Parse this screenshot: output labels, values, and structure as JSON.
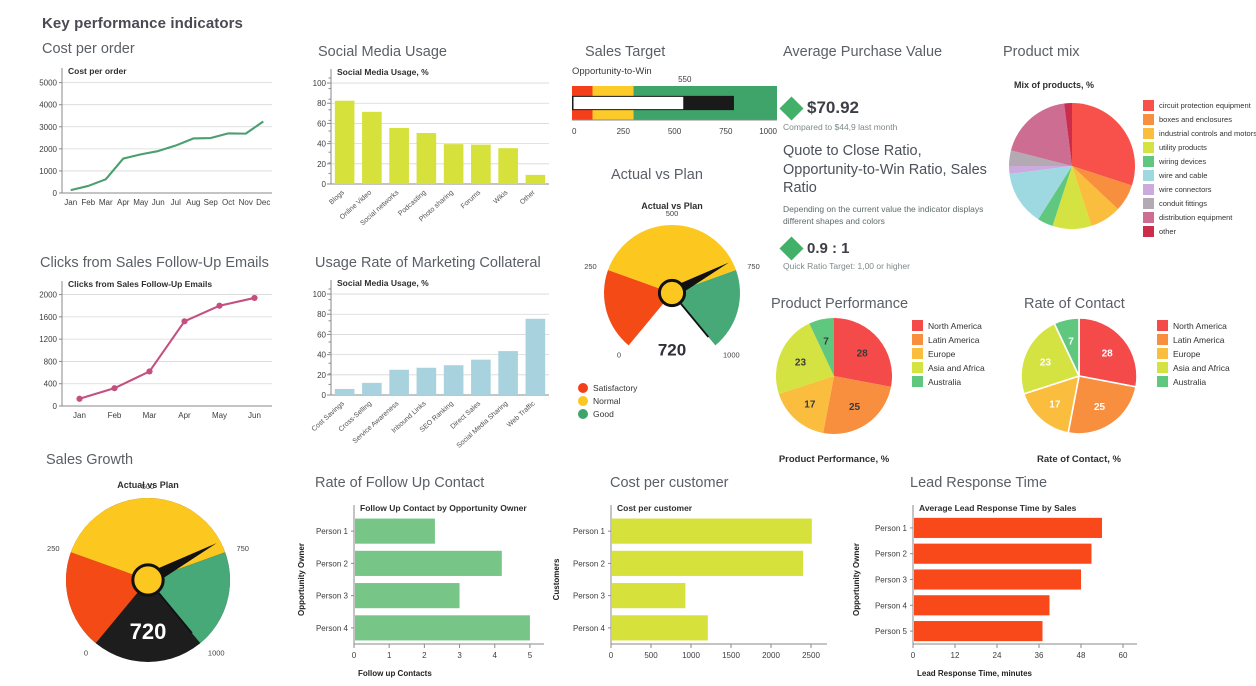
{
  "dashboard": {
    "title": "Key performance indicators"
  },
  "panels": {
    "cost_per_order": "Cost per order",
    "social_media_usage": "Social Media Usage",
    "sales_target": "Sales Target",
    "avg_purchase_value": "Average Purchase Value",
    "product_mix": "Product mix",
    "clicks_followup": "Clicks from Sales Follow-Up Emails",
    "usage_rate_collateral": "Usage Rate of Marketing Collateral",
    "actual_vs_plan": "Actual vs Plan",
    "product_performance": "Product Performance",
    "rate_of_contact": "Rate of Contact",
    "sales_growth": "Sales Growth",
    "rate_followup_contact": "Rate of Follow Up Contact",
    "cost_per_customer": "Cost per customer",
    "lead_response_time": "Lead Response Time"
  },
  "kpi": {
    "value": "$70.92",
    "compare": "Compared to $44,9 last month",
    "heading": "Quote to Close Ratio, Opportunity-to-Win Ratio, Sales Ratio",
    "description": "Depending on the current value the indicator displays different shapes and colors",
    "ratio_value": "0.9 : 1",
    "ratio_target": "Quick Ratio Target: 1,00 or higher",
    "diamond_color": "#43b06a"
  },
  "chart_data": [
    {
      "id": "cost_per_order",
      "type": "line",
      "title": "Cost per order",
      "categories": [
        "Jan",
        "Feb",
        "Mar",
        "Apr",
        "May",
        "Jun",
        "Jul",
        "Aug",
        "Sep",
        "Oct",
        "Nov",
        "Dec"
      ],
      "values": [
        130,
        320,
        620,
        1560,
        1750,
        1900,
        2150,
        2470,
        2490,
        2700,
        2690,
        3240
      ],
      "yticks": [
        0,
        1000,
        2000,
        3000,
        4000,
        5000
      ],
      "ylim": [
        0,
        5300
      ],
      "xlabel": "",
      "ylabel": "",
      "color": "#4a9e6f",
      "grid": true,
      "legend": "none"
    },
    {
      "id": "social_media_usage",
      "type": "bar",
      "title": "Social Media Usage, %",
      "categories": [
        "Blogs",
        "Online Video",
        "Social networks",
        "Podcasting",
        "Photo sharing",
        "Forums",
        "Wikis",
        "Other"
      ],
      "values": [
        82.5,
        71.5,
        55.5,
        50.5,
        39.5,
        39,
        35.5,
        9
      ],
      "yticks": [
        0,
        20,
        40,
        60,
        80,
        100
      ],
      "ylim": [
        0,
        105
      ],
      "color": "#d6e13c",
      "grid": true
    },
    {
      "id": "sales_target",
      "type": "bullet",
      "title": "Opportunity-to-Win",
      "xticks": [
        0,
        250,
        500,
        750,
        1000
      ],
      "xlim": [
        0,
        1000
      ],
      "ranges": [
        {
          "to": 100,
          "color": "#f43f1a"
        },
        {
          "to": 300,
          "color": "#fccb2a"
        },
        {
          "to": 1000,
          "color": "#3fa46a"
        }
      ],
      "measure": 790,
      "marker": 550,
      "marker_label": "550"
    },
    {
      "id": "actual_vs_plan_top",
      "type": "gauge",
      "title": "Actual vs Plan",
      "value": 720,
      "value_label": "720",
      "ticks": [
        0,
        250,
        500,
        750,
        1000
      ],
      "ranges": [
        {
          "from": 0,
          "to": 250,
          "color": "#f44a16",
          "name": "Satisfactory"
        },
        {
          "from": 250,
          "to": 750,
          "color": "#fcc81f",
          "name": "Normal"
        },
        {
          "from": 750,
          "to": 1000,
          "color": "#46a977",
          "name": "Good"
        }
      ],
      "legend": [
        {
          "label": "Satisfactory",
          "color": "#f4401a"
        },
        {
          "label": "Normal",
          "color": "#fcc81f"
        },
        {
          "label": "Good",
          "color": "#3fa46a"
        }
      ]
    },
    {
      "id": "product_mix",
      "type": "pie",
      "title": "Mix of products, %",
      "labels": [
        "circuit protection equipment",
        "boxes and enclosures",
        "industrial controls and motors",
        "utility products",
        "wiring devices",
        "wire and cable",
        "wire connectors",
        "conduit fittings",
        "distribution equipment",
        "other"
      ],
      "values": [
        30,
        7,
        8,
        10,
        4,
        14,
        2,
        4,
        19,
        2
      ],
      "colors": [
        "#f8504a",
        "#f78f3f",
        "#fbbd3d",
        "#d5e342",
        "#5fc77e",
        "#9ed9e2",
        "#ccaade",
        "#b3aab3",
        "#cd6d92",
        "#cc2d4a"
      ],
      "legend": "right",
      "show_values": false
    },
    {
      "id": "clicks_followup",
      "type": "line",
      "title": "Clicks from Sales Follow-Up Emails",
      "categories": [
        "Jan",
        "Feb",
        "Mar",
        "Apr",
        "May",
        "Jun"
      ],
      "values": [
        130,
        320,
        620,
        1520,
        1800,
        1940
      ],
      "yticks": [
        0,
        400,
        800,
        1200,
        1600,
        2000
      ],
      "ylim": [
        0,
        2100
      ],
      "color": "#c35080",
      "markers": true,
      "grid": true
    },
    {
      "id": "usage_rate_collateral",
      "type": "bar",
      "title": "Social Media Usage, %",
      "categories": [
        "Cost Savings",
        "Cross-Selling",
        "Service Awareness",
        "Inbound Links",
        "SEO Ranking",
        "Direct Sales",
        "Social Media Sharing",
        "Web Traffic"
      ],
      "values": [
        6,
        12,
        25,
        27,
        29.5,
        35,
        43.5,
        75.5
      ],
      "yticks": [
        0,
        20,
        40,
        60,
        80,
        100
      ],
      "ylim": [
        0,
        105
      ],
      "color": "#a8d2de",
      "grid": true
    },
    {
      "id": "product_performance",
      "type": "pie",
      "title": "Product Performance, %",
      "labels": [
        "North America",
        "Latin America",
        "Europe",
        "Asia and Africa",
        "Australia"
      ],
      "values": [
        28,
        25,
        17,
        23,
        7
      ],
      "colors": [
        "#f44a4a",
        "#f78f3f",
        "#fbbd3d",
        "#d5e342",
        "#5fc77e"
      ],
      "legend": "right",
      "show_values": true,
      "label_color": "dark"
    },
    {
      "id": "rate_of_contact",
      "type": "pie",
      "title": "Rate of Contact, %",
      "labels": [
        "North America",
        "Latin America",
        "Europe",
        "Asia and Africa",
        "Australia"
      ],
      "values": [
        28,
        25,
        17,
        23,
        7
      ],
      "colors": [
        "#f44a4a",
        "#f78f3f",
        "#fbbd3d",
        "#d5e342",
        "#5fc77e"
      ],
      "legend": "right",
      "show_values": true,
      "label_color": "white"
    },
    {
      "id": "sales_growth",
      "type": "gauge",
      "title": "Actual vs Plan",
      "value": 720,
      "value_label": "720",
      "ticks": [
        0,
        250,
        500,
        750,
        1000
      ],
      "full_circle": true,
      "ranges": [
        {
          "from": 0,
          "to": 250,
          "color": "#f44a16"
        },
        {
          "from": 250,
          "to": 750,
          "color": "#fcc81f"
        },
        {
          "from": 750,
          "to": 1000,
          "color": "#46a977"
        }
      ],
      "bottom_color": "#1d1d1d"
    },
    {
      "id": "rate_followup_contact",
      "type": "bar",
      "orientation": "horizontal",
      "title": "Follow Up Contact by Opportunity Owner",
      "categories": [
        "Person 1",
        "Person 2",
        "Person 3",
        "Person 4"
      ],
      "values": [
        2.3,
        4.2,
        3.0,
        5.0
      ],
      "xticks": [
        0,
        1,
        2,
        3,
        4,
        5
      ],
      "xlim": [
        0,
        5.4
      ],
      "xlabel": "Follow up Contacts",
      "ylabel": "Opportunity Owner",
      "color": "#77c688"
    },
    {
      "id": "cost_per_customer",
      "type": "bar",
      "orientation": "horizontal",
      "title": "Cost per customer",
      "categories": [
        "Person 1",
        "Person 2",
        "Person 3",
        "Person 4"
      ],
      "values": [
        2510,
        2400,
        930,
        1210
      ],
      "xticks": [
        0,
        500,
        1000,
        1500,
        2000,
        2500
      ],
      "xlim": [
        0,
        2700
      ],
      "xlabel": "",
      "ylabel": "Customers",
      "color": "#d6e13c"
    },
    {
      "id": "lead_response_time",
      "type": "bar",
      "orientation": "horizontal",
      "title": "Average Lead Response Time by Sales",
      "categories": [
        "Person 1",
        "Person 2",
        "Person 3",
        "Person 4",
        "Person 5"
      ],
      "values": [
        54,
        51,
        48,
        39,
        37
      ],
      "xticks": [
        0,
        12,
        24,
        36,
        48,
        60
      ],
      "xlim": [
        0,
        64
      ],
      "xlabel": "Lead Response Time, minutes",
      "ylabel": "Opportunity Owner",
      "color": "#f9481a"
    }
  ]
}
